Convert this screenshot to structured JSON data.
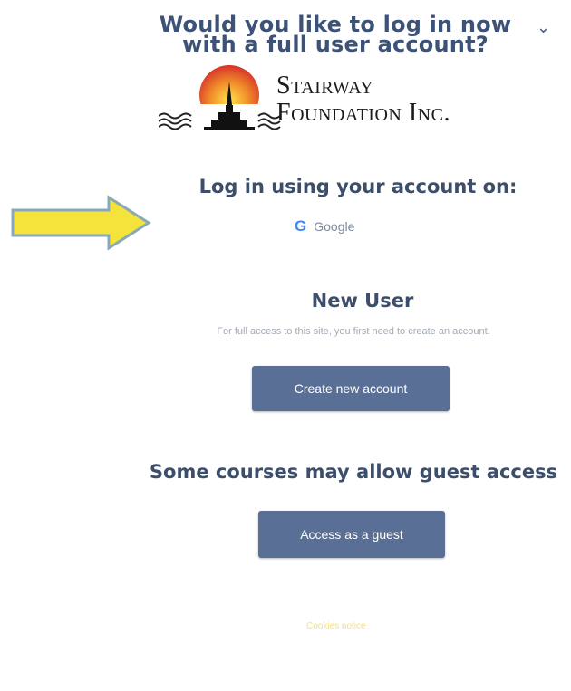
{
  "header": {
    "title": "Would you like to log in now with a full user account?",
    "chevron_icon": "chevron-down-icon"
  },
  "logo": {
    "line1": "Stairway",
    "line2": "Foundation Inc."
  },
  "login": {
    "heading": "Log in using your account on:",
    "provider_label": "Google",
    "provider_icon": "google-icon"
  },
  "new_user": {
    "heading": "New User",
    "text": "For full access to this site, you first need to create an account.",
    "button_label": "Create new account"
  },
  "guest": {
    "heading": "Some courses may allow guest access",
    "button_label": "Access as a guest"
  },
  "footer": {
    "cookies_notice": "Cookies notice"
  },
  "colors": {
    "button_bg": "#5a6f95",
    "heading": "#3d4e6b",
    "arrow_fill": "#f3e33a",
    "arrow_stroke": "#8aa9b8"
  }
}
